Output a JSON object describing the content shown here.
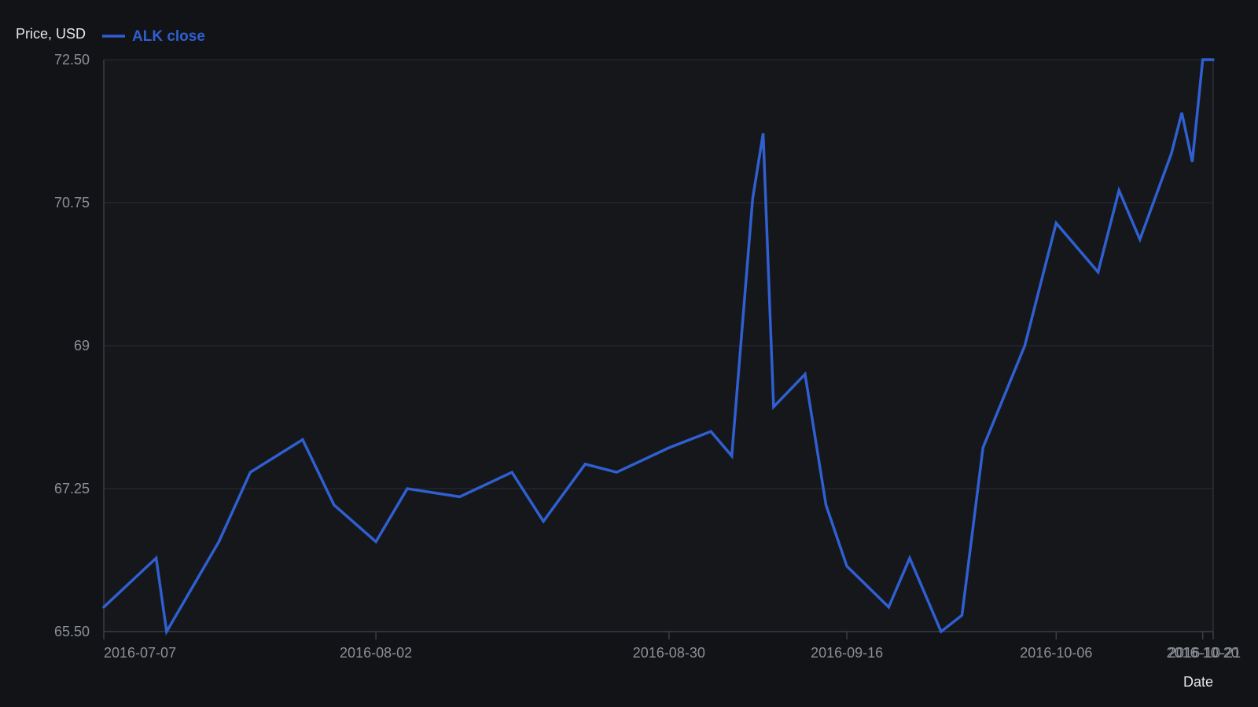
{
  "colors": {
    "background": "#111317",
    "plot_background": "#15171b",
    "grid": "#2a2d33",
    "axis": "#3a3e45",
    "tick_label": "#8b8f96",
    "label": "#e6e6e6",
    "series": "#2f5fd0"
  },
  "chart_data": {
    "type": "line",
    "title": "",
    "xlabel": "Date",
    "ylabel": "Price, USD",
    "ylim": [
      65.5,
      72.5
    ],
    "yticks": [
      {
        "value": 65.5,
        "label": "65.50"
      },
      {
        "value": 67.25,
        "label": "67.25"
      },
      {
        "value": 69,
        "label": "69"
      },
      {
        "value": 70.75,
        "label": "70.75"
      },
      {
        "value": 72.5,
        "label": "72.50"
      }
    ],
    "xlim": [
      "2016-07-07",
      "2016-10-21"
    ],
    "xticks": [
      {
        "value": "2016-07-07",
        "label": "2016-07-07"
      },
      {
        "value": "2016-08-02",
        "label": "2016-08-02"
      },
      {
        "value": "2016-08-30",
        "label": "2016-08-30"
      },
      {
        "value": "2016-09-16",
        "label": "2016-09-16"
      },
      {
        "value": "2016-10-06",
        "label": "2016-10-06"
      },
      {
        "value": "2016-10-20",
        "label": "2016-10-20"
      },
      {
        "value": "2016-10-21",
        "label": "2016-10-21"
      }
    ],
    "grid": true,
    "legend_position": "top-left",
    "series": [
      {
        "name": "ALK close",
        "x": [
          "2016-07-07",
          "2016-07-12",
          "2016-07-13",
          "2016-07-18",
          "2016-07-21",
          "2016-07-26",
          "2016-07-29",
          "2016-08-02",
          "2016-08-05",
          "2016-08-10",
          "2016-08-15",
          "2016-08-18",
          "2016-08-22",
          "2016-08-25",
          "2016-08-30",
          "2016-09-03",
          "2016-09-05",
          "2016-09-07",
          "2016-09-08",
          "2016-09-09",
          "2016-09-12",
          "2016-09-14",
          "2016-09-16",
          "2016-09-20",
          "2016-09-22",
          "2016-09-25",
          "2016-09-27",
          "2016-09-29",
          "2016-10-03",
          "2016-10-06",
          "2016-10-10",
          "2016-10-12",
          "2016-10-14",
          "2016-10-17",
          "2016-10-18",
          "2016-10-19",
          "2016-10-20",
          "2016-10-21"
        ],
        "y": [
          65.8,
          66.4,
          65.5,
          66.6,
          67.45,
          67.85,
          67.05,
          66.6,
          67.25,
          67.15,
          67.45,
          66.85,
          67.55,
          67.45,
          67.75,
          67.95,
          67.65,
          70.8,
          71.6,
          68.25,
          68.65,
          67.05,
          66.3,
          65.8,
          66.4,
          65.5,
          65.7,
          67.75,
          69,
          70.5,
          69.9,
          70.9,
          70.3,
          71.35,
          71.85,
          71.25,
          72.5,
          72.5
        ]
      }
    ]
  }
}
